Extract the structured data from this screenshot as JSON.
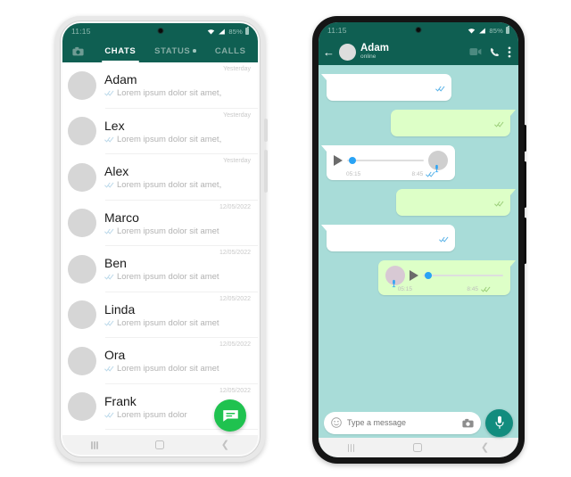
{
  "theme": {
    "header_green": "#0f5f52",
    "chat_bg": "#a8dcd8",
    "bubble_out": "#ddffc7",
    "bubble_in": "#ffffff",
    "fab_green": "#1fc24f",
    "mic_green": "#128c7e",
    "tick_blue": "#5bb3e8",
    "tick_green": "#9ccf7a",
    "waveform_dot": "#29a3f5"
  },
  "left_phone": {
    "status_bar": {
      "time": "11:15",
      "battery_text": "85%",
      "icons": [
        "wifi-icon",
        "cellular-signal-icon",
        "battery-icon"
      ]
    },
    "tabs": {
      "camera_icon": "camera-icon",
      "items": [
        {
          "label": "CHATS",
          "active": true,
          "badge": false
        },
        {
          "label": "STATUS",
          "active": false,
          "badge": true
        },
        {
          "label": "CALLS",
          "active": false,
          "badge": false
        }
      ]
    },
    "chats": [
      {
        "name": "Adam",
        "snippet": "Lorem ipsum dolor sit amet,",
        "time": "Yesterday",
        "ticks": "double-check-icon"
      },
      {
        "name": "Lex",
        "snippet": "Lorem ipsum dolor sit amet,",
        "time": "Yesterday",
        "ticks": "double-check-icon"
      },
      {
        "name": "Alex",
        "snippet": "Lorem ipsum dolor sit amet,",
        "time": "Yesterday",
        "ticks": "double-check-icon"
      },
      {
        "name": "Marco",
        "snippet": "Lorem ipsum dolor sit amet,",
        "time": "12/05/2022",
        "ticks": "double-check-icon"
      },
      {
        "name": "Ben",
        "snippet": "Lorem ipsum dolor sit amet,",
        "time": "12/05/2022",
        "ticks": "double-check-icon"
      },
      {
        "name": "Linda",
        "snippet": "Lorem ipsum dolor sit amet,",
        "time": "12/05/2022",
        "ticks": "double-check-icon"
      },
      {
        "name": "Ora",
        "snippet": "Lorem ipsum dolor sit amet,",
        "time": "12/05/2022",
        "ticks": "double-check-icon"
      },
      {
        "name": "Frank",
        "snippet": "Lorem ipsum dolor",
        "time": "12/05/2022",
        "ticks": "double-check-icon"
      }
    ],
    "fab": {
      "icon": "new-chat-icon",
      "label": ""
    },
    "nav_bar": {
      "recents": "recents-icon",
      "home": "home-icon",
      "back": "back-icon"
    }
  },
  "right_phone": {
    "status_bar": {
      "time": "11:15",
      "battery_text": "85%",
      "icons": [
        "wifi-icon",
        "cellular-signal-icon",
        "battery-icon"
      ]
    },
    "conversation_header": {
      "back": "back-arrow-icon",
      "avatar": "contact-avatar",
      "name": "Adam",
      "status": "online",
      "actions": [
        "video-call-icon",
        "voice-call-icon",
        "more-options-icon"
      ]
    },
    "messages": [
      {
        "type": "text",
        "direction": "in",
        "body": "",
        "ticks": "double-check-icon"
      },
      {
        "type": "text",
        "direction": "out",
        "body": "",
        "ticks": "double-check-icon"
      },
      {
        "type": "voice",
        "direction": "in",
        "duration": "05:15",
        "time": "8:45",
        "ticks": "double-check-icon"
      },
      {
        "type": "text",
        "direction": "out",
        "body": "",
        "ticks": "double-check-icon"
      },
      {
        "type": "text",
        "direction": "in",
        "body": "",
        "ticks": "double-check-icon"
      },
      {
        "type": "voice",
        "direction": "out",
        "duration": "05:15",
        "time": "8:45",
        "ticks": "double-check-icon"
      }
    ],
    "input_bar": {
      "emoji_icon": "emoji-icon",
      "placeholder": "Type a message",
      "value": "",
      "camera_icon": "camera-icon",
      "mic_icon": "microphone-icon"
    },
    "nav_bar": {
      "recents": "recents-icon",
      "home": "home-icon",
      "back": "back-icon"
    }
  }
}
